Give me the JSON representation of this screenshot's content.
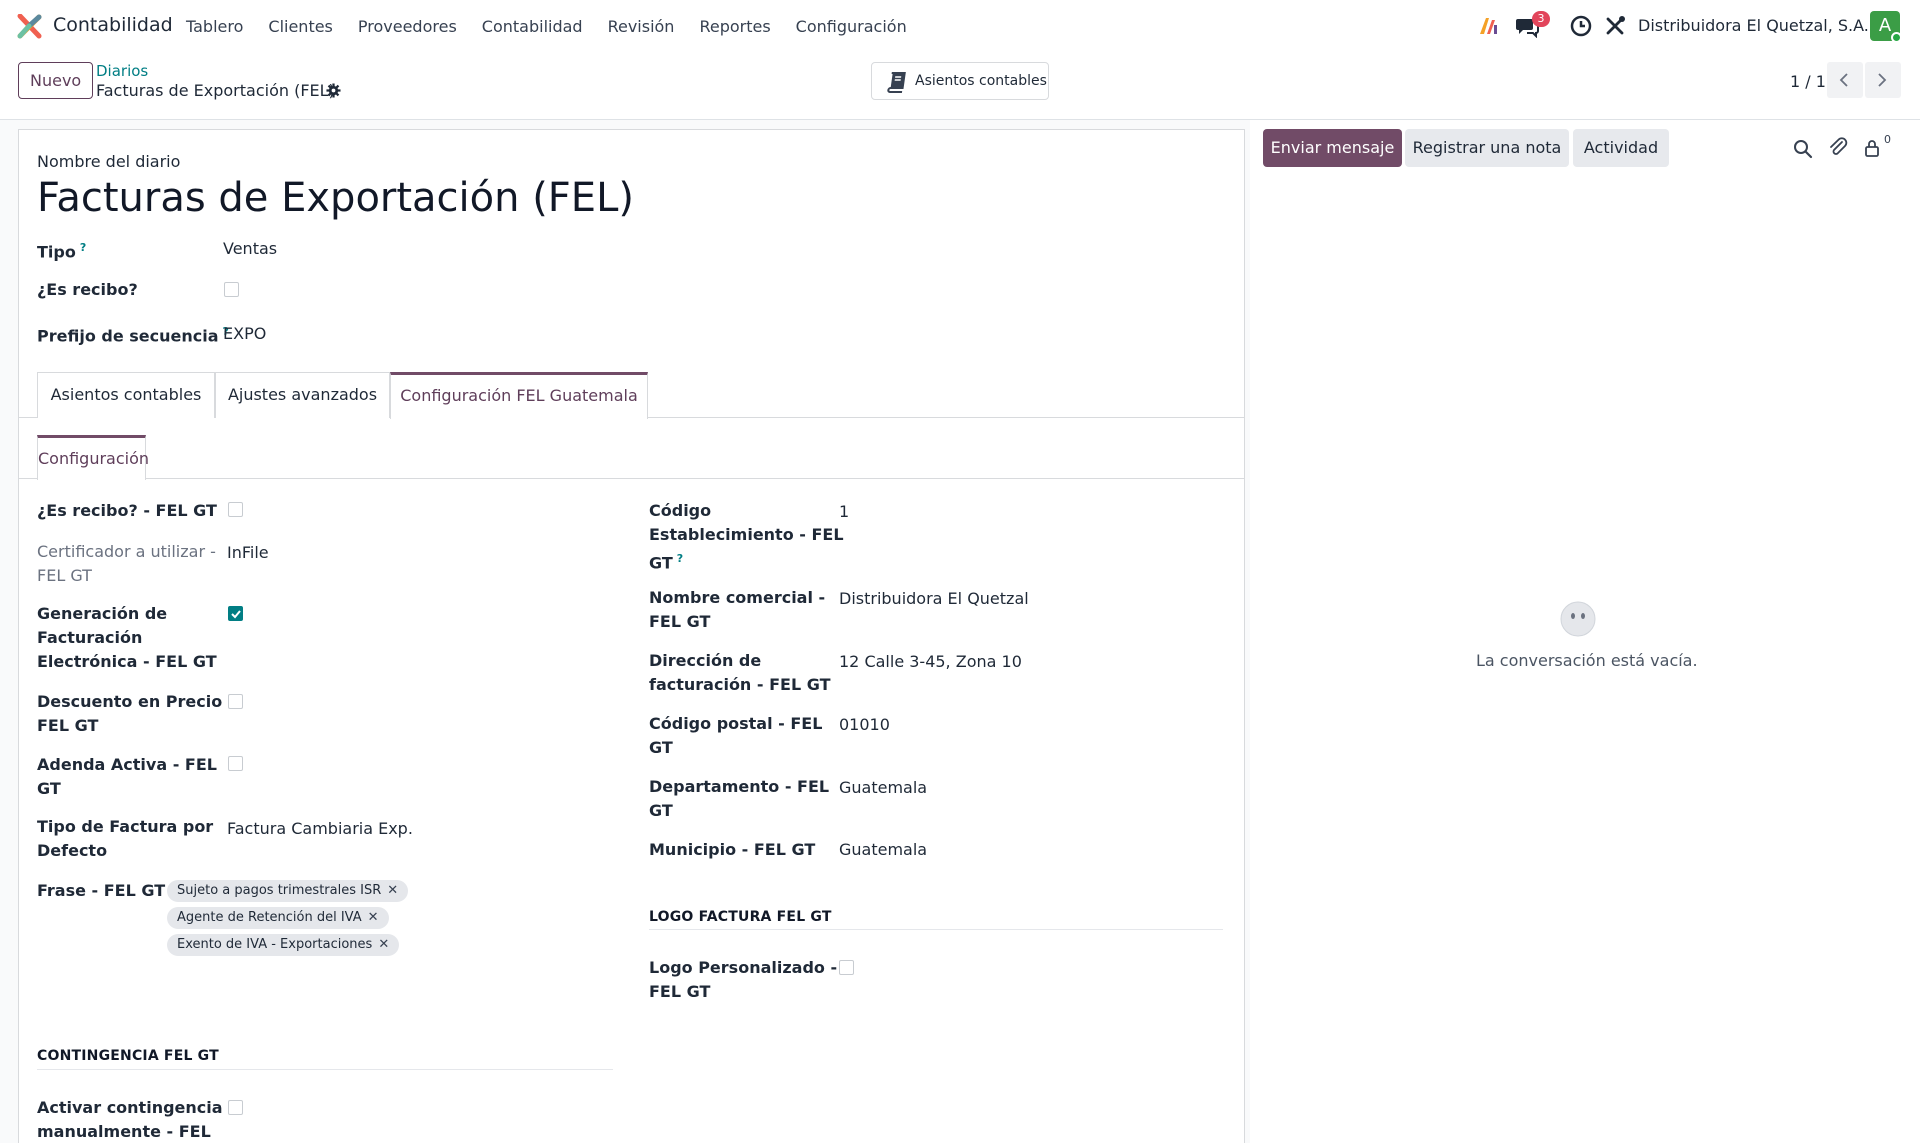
{
  "navbar": {
    "app_name": "Contabilidad",
    "menu": [
      "Tablero",
      "Clientes",
      "Proveedores",
      "Contabilidad",
      "Revisión",
      "Reportes",
      "Configuración"
    ],
    "message_count": "3",
    "company": "Distribuidora El Quetzal, S.A.",
    "avatar_letter": "A"
  },
  "control": {
    "new_label": "Nuevo",
    "breadcrumb_parent": "Diarios",
    "breadcrumb_current": "Facturas de Exportación (FEL)",
    "smart_button": "Asientos contables",
    "pager": "1 / 1"
  },
  "form": {
    "name_label": "Nombre del diario",
    "name": "Facturas de Exportación (FEL)",
    "tipo_label": "Tipo",
    "tipo_help": "?",
    "tipo_value": "Ventas",
    "recibo_label": "¿Es recibo?",
    "prefijo_label": "Prefijo de secuencia",
    "prefijo_help": "?",
    "prefijo_value": "EXPO",
    "tabs": [
      "Asientos contables",
      "Ajustes avanzados",
      "Configuración FEL Guatemala"
    ],
    "subtab": "Configuración"
  },
  "fel_left": {
    "recibo_fel_label": "¿Es recibo? - FEL GT",
    "certificador_label_1": "Certificador a utilizar -",
    "certificador_label_2": "FEL GT",
    "certificador_value": "InFile",
    "generacion_label_1": "Generación de",
    "generacion_label_2": "Facturación",
    "generacion_label_3": "Electrónica - FEL GT",
    "generacion_checked": true,
    "descuento_label_1": "Descuento en Precio -",
    "descuento_label_2": "FEL GT",
    "adenda_label_1": "Adenda Activa - FEL",
    "adenda_label_2": "GT",
    "tipo_factura_label_1": "Tipo de Factura por",
    "tipo_factura_label_2": "Defecto",
    "tipo_factura_value": "Factura Cambiaria Exp.",
    "frase_label": "Frase - FEL GT",
    "frases": [
      "Sujeto a pagos trimestrales ISR",
      "Agente de Retención del IVA",
      "Exento de IVA - Exportaciones"
    ],
    "tag_remove": "✕",
    "contingencia_section": "CONTINGENCIA FEL GT",
    "contingencia_label_1": "Activar contingencia",
    "contingencia_label_2": "manualmente - FEL"
  },
  "fel_right": {
    "codigo_label_1": "Código",
    "codigo_label_2": "Establecimiento - FEL",
    "codigo_label_3": "GT",
    "codigo_help": "?",
    "codigo_value": "1",
    "nombre_label_1": "Nombre comercial -",
    "nombre_label_2": "FEL GT",
    "nombre_value": "Distribuidora El Quetzal",
    "direccion_label_1": "Dirección de",
    "direccion_label_2": "facturación - FEL GT",
    "direccion_value": "12 Calle 3-45, Zona 10",
    "postal_label_1": "Código postal - FEL",
    "postal_label_2": "GT",
    "postal_value": "01010",
    "departamento_label_1": "Departamento - FEL",
    "departamento_label_2": "GT",
    "departamento_value": "Guatemala",
    "municipio_label": "Municipio - FEL GT",
    "municipio_value": "Guatemala",
    "logo_section": "LOGO FACTURA FEL GT",
    "logo_label_1": "Logo Personalizado -",
    "logo_label_2": "FEL GT"
  },
  "chatter": {
    "send_message": "Enviar mensaje",
    "log_note": "Registrar una nota",
    "activity": "Actividad",
    "followers_count": "0",
    "empty_text": "La conversación está vacía."
  },
  "colors": {
    "primary": "#714b67",
    "link": "#017e84",
    "badge": "#e2455b"
  }
}
